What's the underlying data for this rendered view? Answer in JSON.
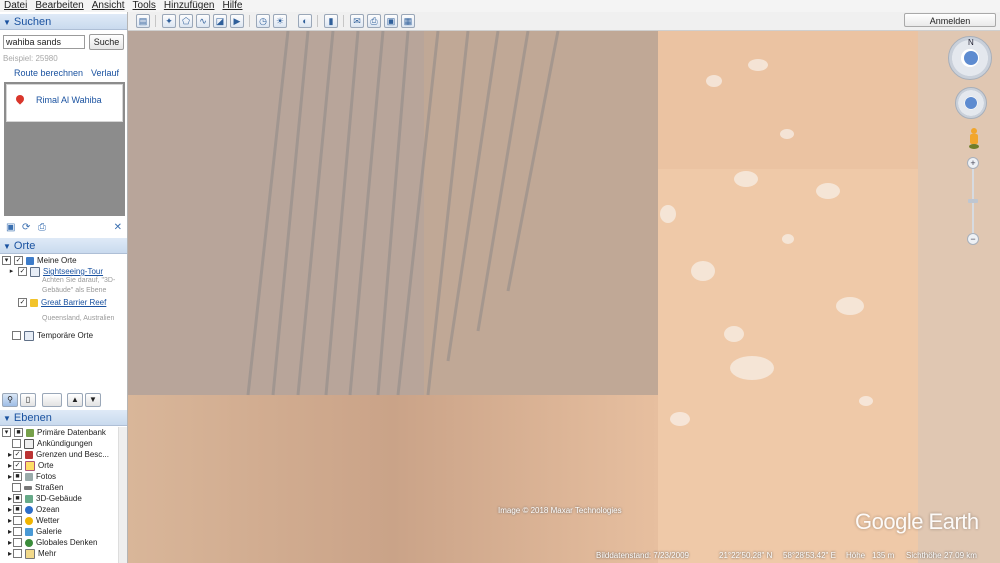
{
  "menu": [
    "Datei",
    "Bearbeiten",
    "Ansicht",
    "Tools",
    "Hinzufügen",
    "Hilfe"
  ],
  "toolbar": {
    "buttons": [
      "sidebar-toggle-icon",
      "add-placemark-icon",
      "add-polygon-icon",
      "add-path-icon",
      "add-overlay-icon",
      "record-tour-icon",
      "historical-imagery-icon",
      "sun-icon",
      "planets-icon",
      "ruler-icon",
      "email-icon",
      "print-icon",
      "save-image-icon",
      "maps-icon"
    ],
    "signin_label": "Anmelden"
  },
  "search": {
    "header": "Suchen",
    "input_value": "wahiba sands",
    "button_label": "Suche",
    "example_text": "Beispiel: 25980",
    "route_label": "Route berechnen",
    "history_label": "Verlauf",
    "result": "Rimal Al Wahiba"
  },
  "places": {
    "header": "Orte",
    "my_places": "Meine Orte",
    "tour": "Sightseeing-Tour",
    "tour_note": "Achten Sie darauf, \"3D-Gebäude\" als Ebene",
    "reef": "Great Barrier Reef",
    "reef_note": "Queensland, Australien",
    "temp": "Temporäre Orte"
  },
  "layers": {
    "header": "Ebenen",
    "primary": "Primäre Datenbank",
    "items": [
      "Ankündigungen",
      "Grenzen und Besc...",
      "Orte",
      "Fotos",
      "Straßen",
      "3D-Gebäude",
      "Ozean",
      "Wetter",
      "Galerie",
      "Globales Denken",
      "Mehr"
    ]
  },
  "map": {
    "compass_n": "N",
    "attribution": "Image © 2018 Maxar Technologies",
    "brand": "Google Earth",
    "status": {
      "date": "Bilddatenstand: 7/23/2009",
      "lat": "21°22'50.28\" N",
      "lon": "58°28'53.42\" E",
      "elev_label": "Höhe",
      "elev": "135 m",
      "eye_label": "Sichthöhe",
      "eye": "27.09 km"
    }
  }
}
